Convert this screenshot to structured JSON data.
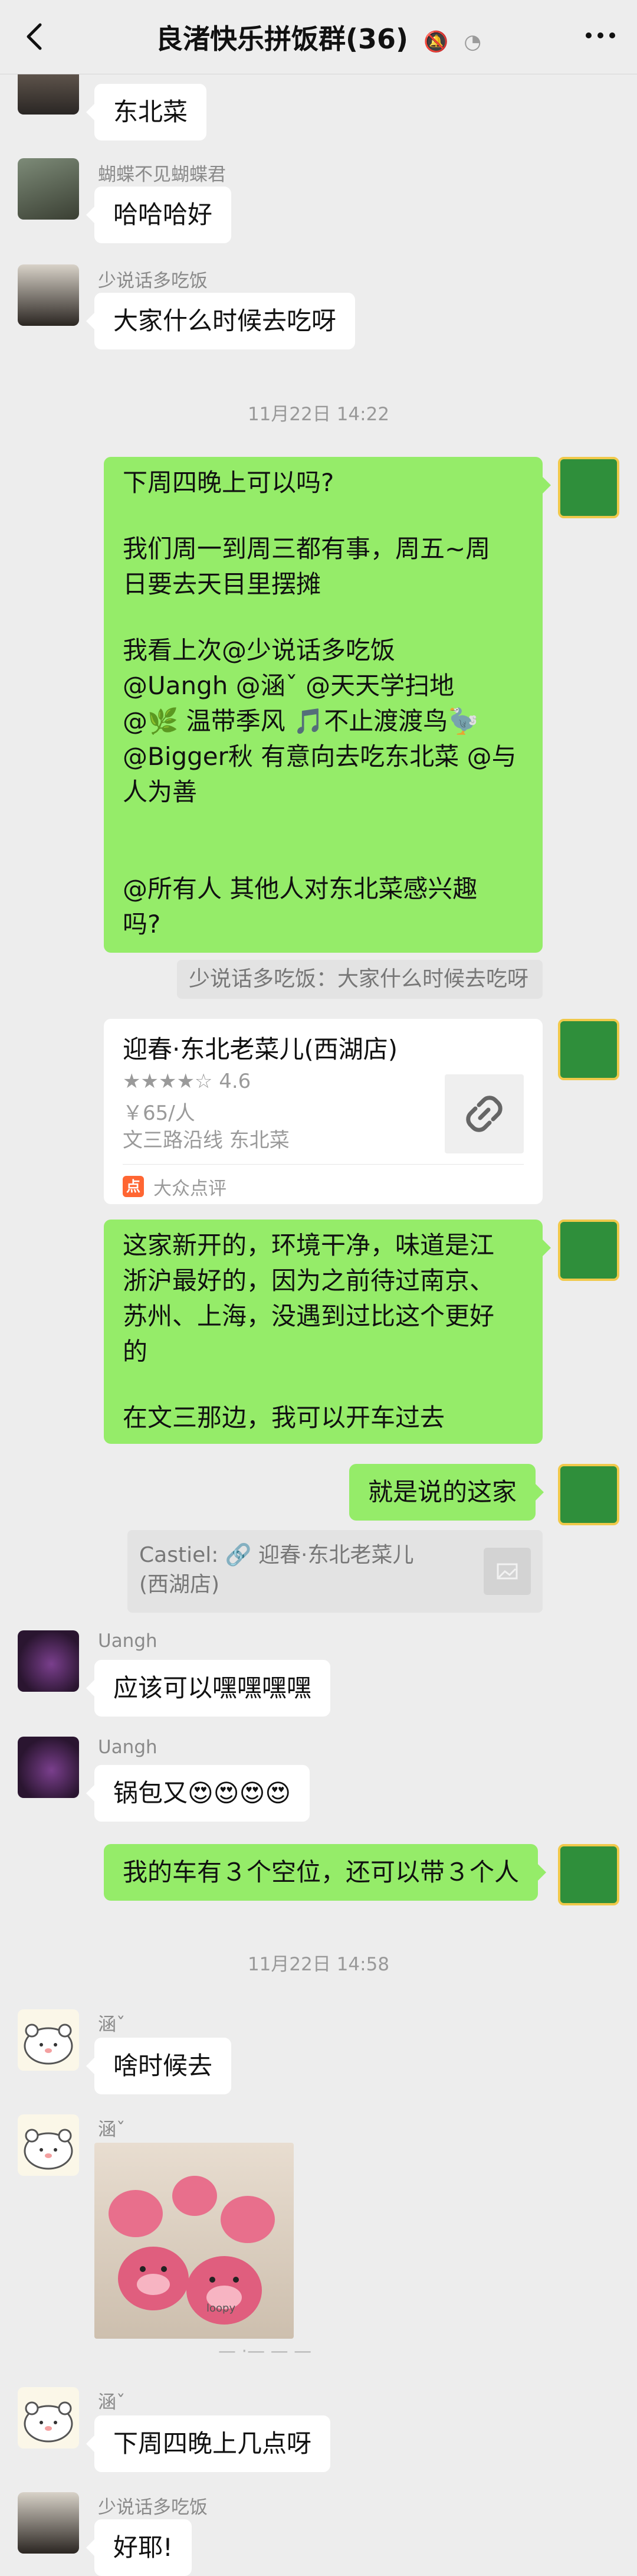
{
  "header": {
    "title": "良渚快乐拼饭群(36)",
    "mute_icon": "bell-off-icon",
    "pin_icon": "ear-icon",
    "back_icon": "chevron-left-icon",
    "more_icon": "more-dots-icon"
  },
  "messages": {
    "m1": {
      "text": "东北菜"
    },
    "m2": {
      "sender": "蝴蝶不见蝴蝶君",
      "text": "哈哈哈好"
    },
    "m3": {
      "sender": "少说话多吃饭",
      "text": "大家什么时候去吃呀"
    },
    "ts1": "11月22日 14:22",
    "m4": {
      "lines": [
        "下周四晚上可以吗?",
        "",
        "我们周一到周三都有事，周五~周",
        "日要去天目里摆摊",
        "",
        "我看上次@少说话多吃饭",
        "@Uangh @涵ˇ @天天学扫地",
        "@🌿 温带季风 🎵不止渡渡鸟🦤",
        "@Bigger秋 有意向去吃东北菜 @与",
        "人为善",
        "",
        "",
        "@所有人 其他人对东北菜感兴趣",
        "吗?"
      ],
      "quote": "少说话多吃饭：大家什么时候去吃呀"
    },
    "m5": {
      "title": "迎春·东北老菜儿(西湖店)",
      "stars": "★★★★☆ 4.6",
      "price": "￥65/人",
      "address": "文三路沿线 东北菜",
      "source": "大众点评",
      "link_icon": "link-icon"
    },
    "m6": {
      "lines": [
        "这家新开的，环境干净，味道是江",
        "浙沪最好的，因为之前待过南京、",
        "苏州、上海，没遇到过比这个更好",
        "的",
        "",
        "在文三那边，我可以开车过去"
      ]
    },
    "m7": {
      "text": "就是说的这家",
      "quote": "Castiel: 🔗 迎春·东北老菜儿(西湖店)"
    },
    "m8": {
      "sender": "Uangh",
      "text": "应该可以嘿嘿嘿嘿"
    },
    "m9": {
      "sender": "Uangh",
      "text": "锅包又😍😍😍😍"
    },
    "m10": {
      "text": "我的车有３个空位，还可以带３个人"
    },
    "ts2": "11月22日 14:58",
    "m11": {
      "sender": "涵ˇ",
      "text": "啥时候去"
    },
    "m12": {
      "sender": "涵ˇ",
      "sticker_caption": "loopy"
    },
    "m13": {
      "sender": "涵ˇ",
      "text": "下周四晚上几点呀"
    },
    "m14": {
      "sender": "少说话多吃饭",
      "text": "好耶!"
    }
  },
  "colors": {
    "out_bubble": "#95ec69",
    "in_bubble": "#ffffff",
    "background": "#ededed"
  }
}
